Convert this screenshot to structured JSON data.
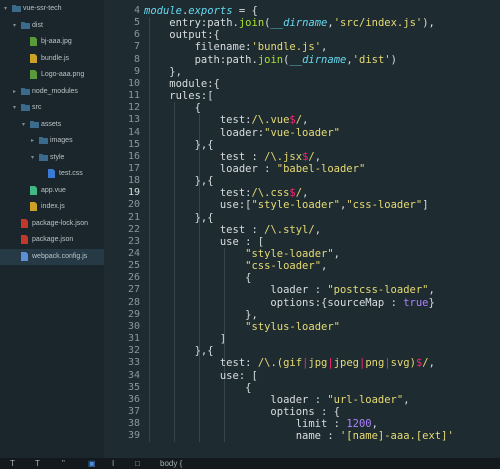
{
  "sidebar": {
    "items": [
      {
        "label": "vue-ssr-tech",
        "depth": 0,
        "kind": "folder",
        "open": true
      },
      {
        "label": "dist",
        "depth": 1,
        "kind": "folder",
        "open": true
      },
      {
        "label": "bj-aaa.jpg",
        "depth": 2,
        "kind": "image"
      },
      {
        "label": "bundle.js",
        "depth": 2,
        "kind": "js"
      },
      {
        "label": "Logo-aaa.png",
        "depth": 2,
        "kind": "image"
      },
      {
        "label": "node_modules",
        "depth": 1,
        "kind": "folder",
        "open": false
      },
      {
        "label": "src",
        "depth": 1,
        "kind": "folder",
        "open": true
      },
      {
        "label": "assets",
        "depth": 2,
        "kind": "folder",
        "open": true
      },
      {
        "label": "images",
        "depth": 3,
        "kind": "folder",
        "open": false
      },
      {
        "label": "style",
        "depth": 3,
        "kind": "folder",
        "open": true
      },
      {
        "label": "test.css",
        "depth": 4,
        "kind": "css"
      },
      {
        "label": "app.vue",
        "depth": 2,
        "kind": "vue"
      },
      {
        "label": "index.js",
        "depth": 2,
        "kind": "js"
      },
      {
        "label": "package-lock.json",
        "depth": 1,
        "kind": "json"
      },
      {
        "label": "package.json",
        "depth": 1,
        "kind": "json"
      },
      {
        "label": "webpack.config.js",
        "depth": 1,
        "kind": "config",
        "selected": true
      }
    ]
  },
  "editor": {
    "active_line": "19",
    "line_numbers": [
      "4",
      "5",
      "6",
      "7",
      "8",
      "9",
      "10",
      "11",
      "12",
      "13",
      "14",
      "15",
      "16",
      "17",
      "18",
      "19",
      "20",
      "21",
      "22",
      "23",
      "24",
      "25",
      "26",
      "27",
      "28",
      "29",
      "30",
      "31",
      "32",
      "33",
      "34",
      "35",
      "36",
      "37",
      "38",
      "39"
    ],
    "lines": [
      [
        {
          "t": "module",
          "c": "t-kw t-it"
        },
        {
          "t": ".",
          "c": ""
        },
        {
          "t": "exports",
          "c": "t-kw t-it"
        },
        {
          "t": " = {",
          "c": ""
        }
      ],
      [
        {
          "t": "    entry",
          "c": ""
        },
        {
          "t": ":",
          "c": ""
        },
        {
          "t": "path",
          "c": ""
        },
        {
          "t": ".",
          "c": ""
        },
        {
          "t": "join",
          "c": "t-fn"
        },
        {
          "t": "(",
          "c": ""
        },
        {
          "t": "__dirname",
          "c": "t-kw t-it"
        },
        {
          "t": ",",
          "c": ""
        },
        {
          "t": "'src/index.js'",
          "c": "t-str"
        },
        {
          "t": "),",
          "c": ""
        }
      ],
      [
        {
          "t": "    output",
          "c": ""
        },
        {
          "t": ":{",
          "c": ""
        }
      ],
      [
        {
          "t": "        filename",
          "c": ""
        },
        {
          "t": ":",
          "c": ""
        },
        {
          "t": "'bundle.js'",
          "c": "t-str"
        },
        {
          "t": ",",
          "c": ""
        }
      ],
      [
        {
          "t": "        path",
          "c": ""
        },
        {
          "t": ":",
          "c": ""
        },
        {
          "t": "path",
          "c": ""
        },
        {
          "t": ".",
          "c": ""
        },
        {
          "t": "join",
          "c": "t-fn"
        },
        {
          "t": "(",
          "c": ""
        },
        {
          "t": "__dirname",
          "c": "t-kw t-it"
        },
        {
          "t": ",",
          "c": ""
        },
        {
          "t": "'dist'",
          "c": "t-str"
        },
        {
          "t": ")",
          "c": ""
        }
      ],
      [
        {
          "t": "    },",
          "c": ""
        }
      ],
      [
        {
          "t": "    module",
          "c": ""
        },
        {
          "t": ":{",
          "c": ""
        }
      ],
      [
        {
          "t": "    rules",
          "c": ""
        },
        {
          "t": ":[",
          "c": ""
        }
      ],
      [
        {
          "t": "        {",
          "c": ""
        }
      ],
      [
        {
          "t": "            test",
          "c": ""
        },
        {
          "t": ":",
          "c": ""
        },
        {
          "t": "/\\.vue",
          "c": "t-re"
        },
        {
          "t": "$",
          "c": "t-op"
        },
        {
          "t": "/",
          "c": "t-re"
        },
        {
          "t": ",",
          "c": ""
        }
      ],
      [
        {
          "t": "            loader",
          "c": ""
        },
        {
          "t": ":",
          "c": ""
        },
        {
          "t": "\"vue-loader\"",
          "c": "t-str"
        }
      ],
      [
        {
          "t": "        },{",
          "c": ""
        }
      ],
      [
        {
          "t": "            test ",
          "c": ""
        },
        {
          "t": ": ",
          "c": ""
        },
        {
          "t": "/\\.jsx",
          "c": "t-re"
        },
        {
          "t": "$",
          "c": "t-op"
        },
        {
          "t": "/",
          "c": "t-re"
        },
        {
          "t": ",",
          "c": ""
        }
      ],
      [
        {
          "t": "            loader ",
          "c": ""
        },
        {
          "t": ": ",
          "c": ""
        },
        {
          "t": "\"babel-loader\"",
          "c": "t-str"
        }
      ],
      [
        {
          "t": "        },{",
          "c": ""
        }
      ],
      [
        {
          "t": "            test",
          "c": ""
        },
        {
          "t": ":",
          "c": ""
        },
        {
          "t": "/\\.css",
          "c": "t-re"
        },
        {
          "t": "$",
          "c": "t-op"
        },
        {
          "t": "/",
          "c": "t-re"
        },
        {
          "t": ",",
          "c": ""
        }
      ],
      [
        {
          "t": "            use",
          "c": ""
        },
        {
          "t": ":[",
          "c": ""
        },
        {
          "t": "\"style-loader\"",
          "c": "t-str"
        },
        {
          "t": ",",
          "c": ""
        },
        {
          "t": "\"css-loader\"",
          "c": "t-str"
        },
        {
          "t": "]",
          "c": ""
        }
      ],
      [
        {
          "t": "        },{",
          "c": ""
        }
      ],
      [
        {
          "t": "            test ",
          "c": ""
        },
        {
          "t": ": ",
          "c": ""
        },
        {
          "t": "/\\.styl/",
          "c": "t-re"
        },
        {
          "t": ",",
          "c": ""
        }
      ],
      [
        {
          "t": "            use ",
          "c": ""
        },
        {
          "t": ": [",
          "c": ""
        }
      ],
      [
        {
          "t": "                ",
          "c": ""
        },
        {
          "t": "\"style-loader\"",
          "c": "t-str"
        },
        {
          "t": ",",
          "c": ""
        }
      ],
      [
        {
          "t": "                ",
          "c": ""
        },
        {
          "t": "\"css-loader\"",
          "c": "t-str"
        },
        {
          "t": ",",
          "c": ""
        }
      ],
      [
        {
          "t": "                {",
          "c": ""
        }
      ],
      [
        {
          "t": "                    loader ",
          "c": ""
        },
        {
          "t": ": ",
          "c": ""
        },
        {
          "t": "\"postcss-loader\"",
          "c": "t-str"
        },
        {
          "t": ",",
          "c": ""
        }
      ],
      [
        {
          "t": "                    options",
          "c": ""
        },
        {
          "t": ":{",
          "c": ""
        },
        {
          "t": "sourceMap ",
          "c": ""
        },
        {
          "t": ": ",
          "c": ""
        },
        {
          "t": "true",
          "c": "t-num"
        },
        {
          "t": "}",
          "c": ""
        }
      ],
      [
        {
          "t": "                },",
          "c": ""
        }
      ],
      [
        {
          "t": "                ",
          "c": ""
        },
        {
          "t": "\"stylus-loader\"",
          "c": "t-str"
        }
      ],
      [
        {
          "t": "            ]",
          "c": ""
        }
      ],
      [
        {
          "t": "        },{",
          "c": ""
        }
      ],
      [
        {
          "t": "            test",
          "c": ""
        },
        {
          "t": ": ",
          "c": ""
        },
        {
          "t": "/\\.(gif",
          "c": "t-re"
        },
        {
          "t": "|",
          "c": "t-op"
        },
        {
          "t": "jpg",
          "c": "t-re"
        },
        {
          "t": "|",
          "c": "t-op"
        },
        {
          "t": "jpeg",
          "c": "t-re"
        },
        {
          "t": "|",
          "c": "t-op"
        },
        {
          "t": "png",
          "c": "t-re"
        },
        {
          "t": "|",
          "c": "t-op"
        },
        {
          "t": "svg)",
          "c": "t-re"
        },
        {
          "t": "$",
          "c": "t-op"
        },
        {
          "t": "/",
          "c": "t-re"
        },
        {
          "t": ",",
          "c": ""
        }
      ],
      [
        {
          "t": "            use",
          "c": ""
        },
        {
          "t": ": [",
          "c": ""
        }
      ],
      [
        {
          "t": "                {",
          "c": ""
        }
      ],
      [
        {
          "t": "                    loader ",
          "c": ""
        },
        {
          "t": ": ",
          "c": ""
        },
        {
          "t": "\"url-loader\"",
          "c": "t-str"
        },
        {
          "t": ",",
          "c": ""
        }
      ],
      [
        {
          "t": "                    options ",
          "c": ""
        },
        {
          "t": ": {",
          "c": ""
        }
      ],
      [
        {
          "t": "                        limit ",
          "c": ""
        },
        {
          "t": ": ",
          "c": ""
        },
        {
          "t": "1200",
          "c": "t-num"
        },
        {
          "t": ",",
          "c": ""
        }
      ],
      [
        {
          "t": "                        name ",
          "c": ""
        },
        {
          "t": ": ",
          "c": ""
        },
        {
          "t": "'[name]-aaa.[ext]'",
          "c": "t-str"
        }
      ]
    ]
  },
  "statusbar": {
    "items": [
      "T",
      "T",
      "\"",
      "▣",
      "I",
      "□",
      "body {"
    ]
  },
  "colors": {
    "sidebar_bg": "#1b262c",
    "editor_bg": "#1e2b31",
    "selected_bg": "#263a45",
    "string": "#e6db74",
    "keyword": "#66d9ef",
    "function": "#a6e22e",
    "number": "#ae81ff",
    "operator": "#f92672"
  }
}
